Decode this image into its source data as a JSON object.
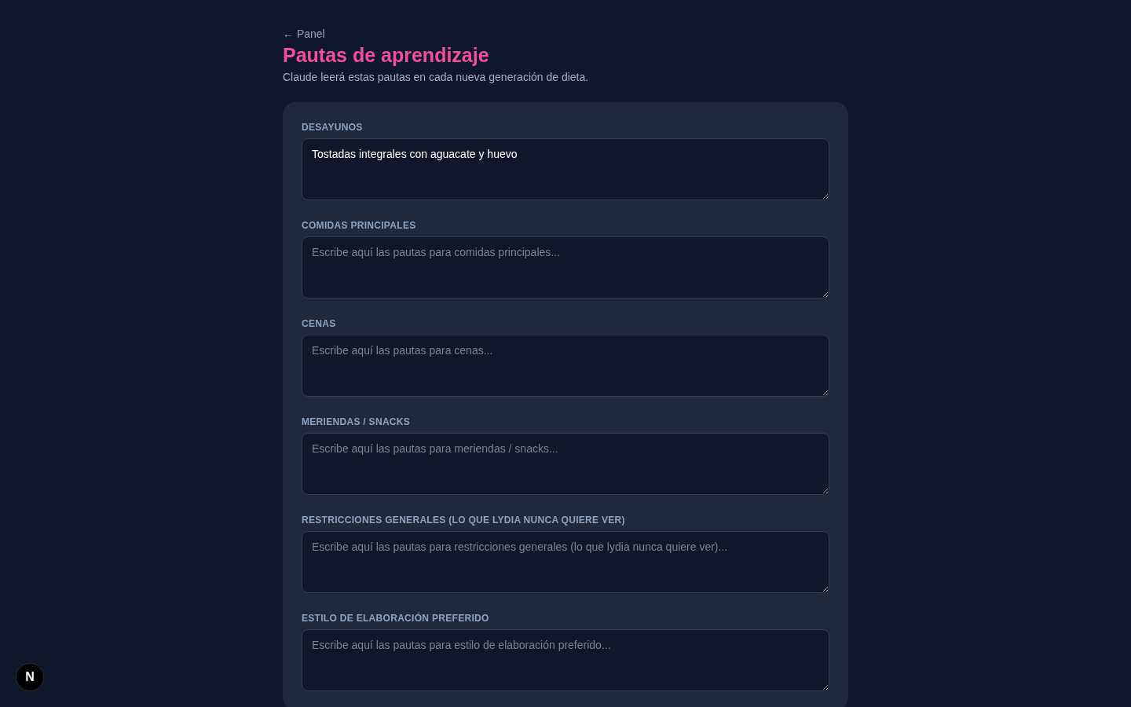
{
  "back_link": {
    "label": "← Panel"
  },
  "header": {
    "title": "Pautas de aprendizaje",
    "subtitle": "Claude leerá estas pautas en cada nueva generación de dieta."
  },
  "fields": [
    {
      "label": "DESAYUNOS",
      "value": "Tostadas integrales con aguacate y huevo"
    },
    {
      "label": "COMIDAS PRINCIPALES",
      "placeholder": "Escribe aquí las pautas para comidas principales..."
    },
    {
      "label": "CENAS",
      "placeholder": "Escribe aquí las pautas para cenas..."
    },
    {
      "label": "MERIENDAS / SNACKS",
      "placeholder": "Escribe aquí las pautas para meriendas / snacks..."
    },
    {
      "label": "RESTRICCIONES GENERALES (LO QUE LYDIA NUNCA QUIERE VER)",
      "placeholder": "Escribe aquí las pautas para restricciones generales (lo que lydia nunca quiere ver)..."
    },
    {
      "label": "ESTILO DE ELABORACIÓN PREFERIDO",
      "placeholder": "Escribe aquí las pautas para estilo de elaboración preferido..."
    }
  ],
  "dev_badge": {
    "label": "N"
  }
}
